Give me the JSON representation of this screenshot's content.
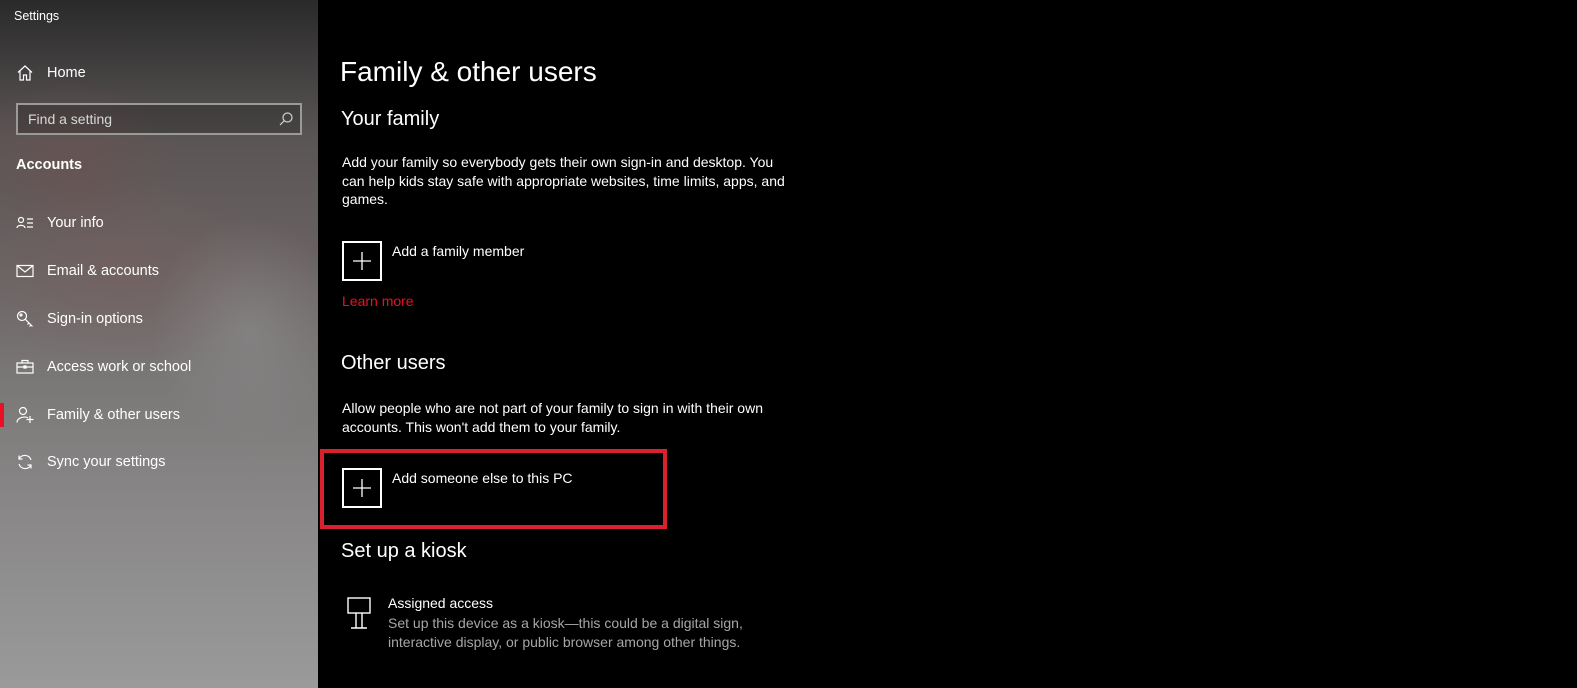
{
  "app": {
    "title": "Settings"
  },
  "sidebar": {
    "home_label": "Home",
    "search_placeholder": "Find a setting",
    "section_title": "Accounts",
    "items": [
      {
        "label": "Your info",
        "icon": "contact-card-icon"
      },
      {
        "label": "Email & accounts",
        "icon": "mail-icon"
      },
      {
        "label": "Sign-in options",
        "icon": "key-icon"
      },
      {
        "label": "Access work or school",
        "icon": "briefcase-icon"
      },
      {
        "label": "Family & other users",
        "icon": "add-person-icon",
        "selected": true
      },
      {
        "label": "Sync your settings",
        "icon": "sync-icon"
      }
    ]
  },
  "main": {
    "page_title": "Family & other users",
    "family": {
      "heading": "Your family",
      "description": "Add your family so everybody gets their own sign-in and desktop. You can help kids stay safe with appropriate websites, time limits, apps, and games.",
      "add_label": "Add a family member",
      "learn_more": "Learn more"
    },
    "other_users": {
      "heading": "Other users",
      "description": "Allow people who are not part of your family to sign in with their own accounts. This won't add them to your family.",
      "add_label": "Add someone else to this PC"
    },
    "kiosk": {
      "heading": "Set up a kiosk",
      "title": "Assigned access",
      "description": "Set up this device as a kiosk—this could be a digital sign, interactive display, or public browser among other things."
    }
  },
  "colors": {
    "accent": "#e81123",
    "highlight": "#d9222e",
    "background": "#000000"
  }
}
